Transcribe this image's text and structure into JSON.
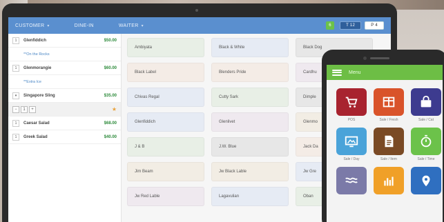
{
  "topbar": {
    "tabs": [
      {
        "label": "CUSTOMER",
        "caret": "▾"
      },
      {
        "label": "DINE-IN",
        "caret": ""
      },
      {
        "label": "WAITER",
        "caret": "▾"
      }
    ],
    "badge": "6",
    "blue_button": "T 12",
    "white_button": "P 4"
  },
  "order": {
    "rows": [
      {
        "type": "item",
        "qty": "1",
        "name": "Glenfiddich",
        "price": "$50.00"
      },
      {
        "type": "note",
        "text": "**On the Rocks"
      },
      {
        "type": "item",
        "qty": "1",
        "name": "Glenmorangie",
        "price": "$60.00"
      },
      {
        "type": "note",
        "text": "**Extra Ice"
      },
      {
        "type": "item",
        "qty": "▾",
        "name": "Singapore Sling",
        "price": "$35.00"
      },
      {
        "type": "stepper",
        "minus": "−",
        "value": "1",
        "plus": "+",
        "star": "★"
      },
      {
        "type": "item",
        "qty": "1",
        "name": "Caesar Salad",
        "price": "$68.00"
      },
      {
        "type": "item",
        "qty": "1",
        "name": "Greek Salad",
        "price": "$40.00"
      }
    ]
  },
  "products": [
    [
      "Ambiyata",
      "Black & White",
      "Black Dog"
    ],
    [
      "Black Label",
      "Blenders Pride",
      "Cardhu"
    ],
    [
      "Chivas Regal",
      "Cutty Sark",
      "Dimple"
    ],
    [
      "Glenfiddich",
      "Glenlivet",
      "Glenmo"
    ],
    [
      "J & B",
      "J.W. Blue",
      "Jack Da"
    ],
    [
      "Jim Beam",
      "Jw Black Lable",
      "Jw Gre"
    ],
    [
      "Jw Red Lable",
      "Lagavulian",
      "Oban"
    ]
  ],
  "product_colors": [
    [
      "c0",
      "c1",
      "c4"
    ],
    [
      "c2",
      "c2",
      "c3"
    ],
    [
      "c1",
      "c0",
      "c4"
    ],
    [
      "c1",
      "c3",
      "c5"
    ],
    [
      "c0",
      "c4",
      "c2"
    ],
    [
      "c5",
      "c5",
      "c1"
    ],
    [
      "c3",
      "c1",
      "c0"
    ]
  ],
  "phone": {
    "title": "Menu",
    "apps": [
      {
        "label": "POS",
        "color": "#a8232f",
        "icon": "cart-icon"
      },
      {
        "label": "Sale / Fresh",
        "color": "#d9532a",
        "icon": "grid-icon"
      },
      {
        "label": "Sale / Cat",
        "color": "#3d3b8f",
        "icon": "bag-icon"
      },
      {
        "label": "Sale / Day",
        "color": "#4aa3d9",
        "icon": "screen-icon"
      },
      {
        "label": "Sale / Item",
        "color": "#7a4a25",
        "icon": "document-icon"
      },
      {
        "label": "Sale / Time",
        "color": "#6cc24a",
        "icon": "timer-icon"
      },
      {
        "label": "",
        "color": "#7b7aa8",
        "icon": "wave-icon"
      },
      {
        "label": "",
        "color": "#f0a028",
        "icon": "bar-chart-icon"
      },
      {
        "label": "",
        "color": "#2f6fc0",
        "icon": "location-pin-icon"
      }
    ]
  }
}
